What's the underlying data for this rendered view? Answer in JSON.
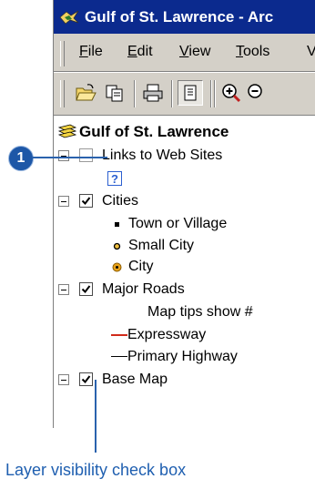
{
  "window": {
    "title": "Gulf of St. Lawrence - Arc"
  },
  "menu": [
    {
      "prefix": "",
      "u": "F",
      "rest": "ile"
    },
    {
      "prefix": "",
      "u": "E",
      "rest": "dit"
    },
    {
      "prefix": "",
      "u": "V",
      "rest": "iew"
    },
    {
      "prefix": "",
      "u": "T",
      "rest": "ools"
    }
  ],
  "toolbar": {
    "buttons": [
      "open-folder-icon",
      "copy-icon",
      "print-icon",
      "toc-icon",
      "zoom-in-icon",
      "zoom-out-icon"
    ]
  },
  "toc": {
    "root": "Gulf of St. Lawrence",
    "layers": [
      {
        "name": "Links to Web Sites",
        "checked": false
      },
      {
        "name": "Cities",
        "checked": true
      },
      {
        "name": "Major Roads",
        "checked": true
      },
      {
        "name": "Base Map",
        "checked": true
      }
    ],
    "cities_legend": [
      "Town or Village",
      "Small City",
      "City"
    ],
    "roads_note": "Map tips show #",
    "roads_legend": [
      "Expressway",
      "Primary Highway"
    ]
  },
  "callout": {
    "number": "1",
    "caption": "Layer visibility check box"
  },
  "colors": {
    "titlebar": "#0b2a8e",
    "callout": "#1f5fb0",
    "expressway": "#d02a1a",
    "city_marker": "#e8a21a"
  }
}
